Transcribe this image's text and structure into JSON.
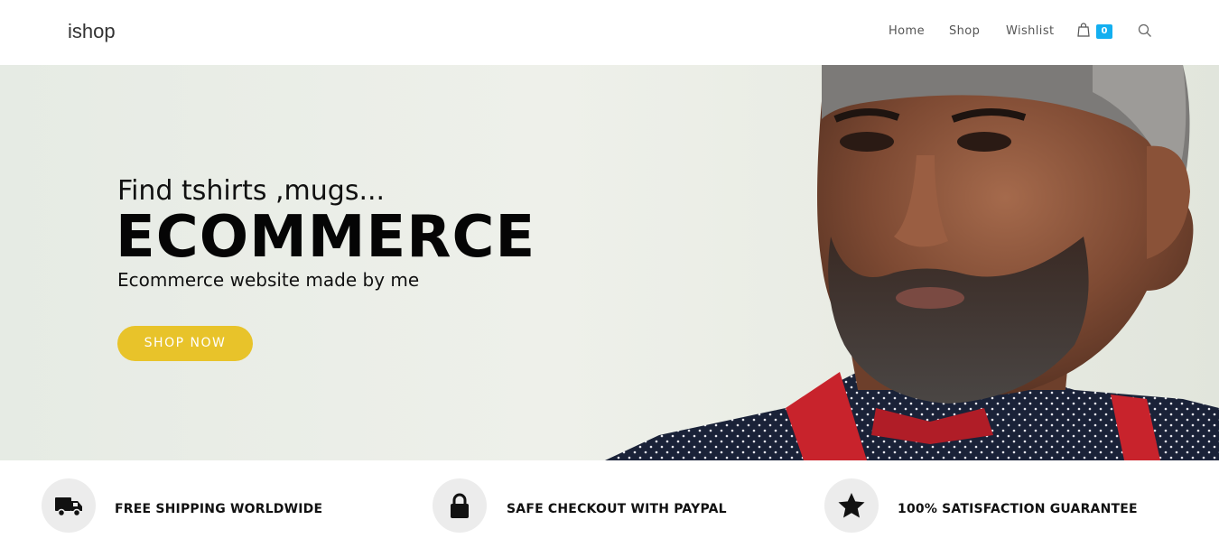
{
  "header": {
    "logo": "ishop",
    "nav": [
      {
        "label": "Home"
      },
      {
        "label": "Shop"
      },
      {
        "label": "Wishlist"
      }
    ],
    "cart_count": "0",
    "cart_icon": "shopping-bag-icon",
    "search_icon": "search-icon",
    "accent": "#13aff0"
  },
  "hero": {
    "subtitle": "Find tshirts ,mugs...",
    "title": "ECOMMERCE",
    "description": "Ecommerce website made by me",
    "button_label": "SHOP NOW",
    "button_color": "#e8c32a"
  },
  "features": [
    {
      "icon": "truck-icon",
      "label": "FREE SHIPPING WORLDWIDE"
    },
    {
      "icon": "lock-icon",
      "label": "SAFE CHECKOUT WITH PAYPAL"
    },
    {
      "icon": "star-icon",
      "label": "100% SATISFACTION GUARANTEE"
    }
  ]
}
